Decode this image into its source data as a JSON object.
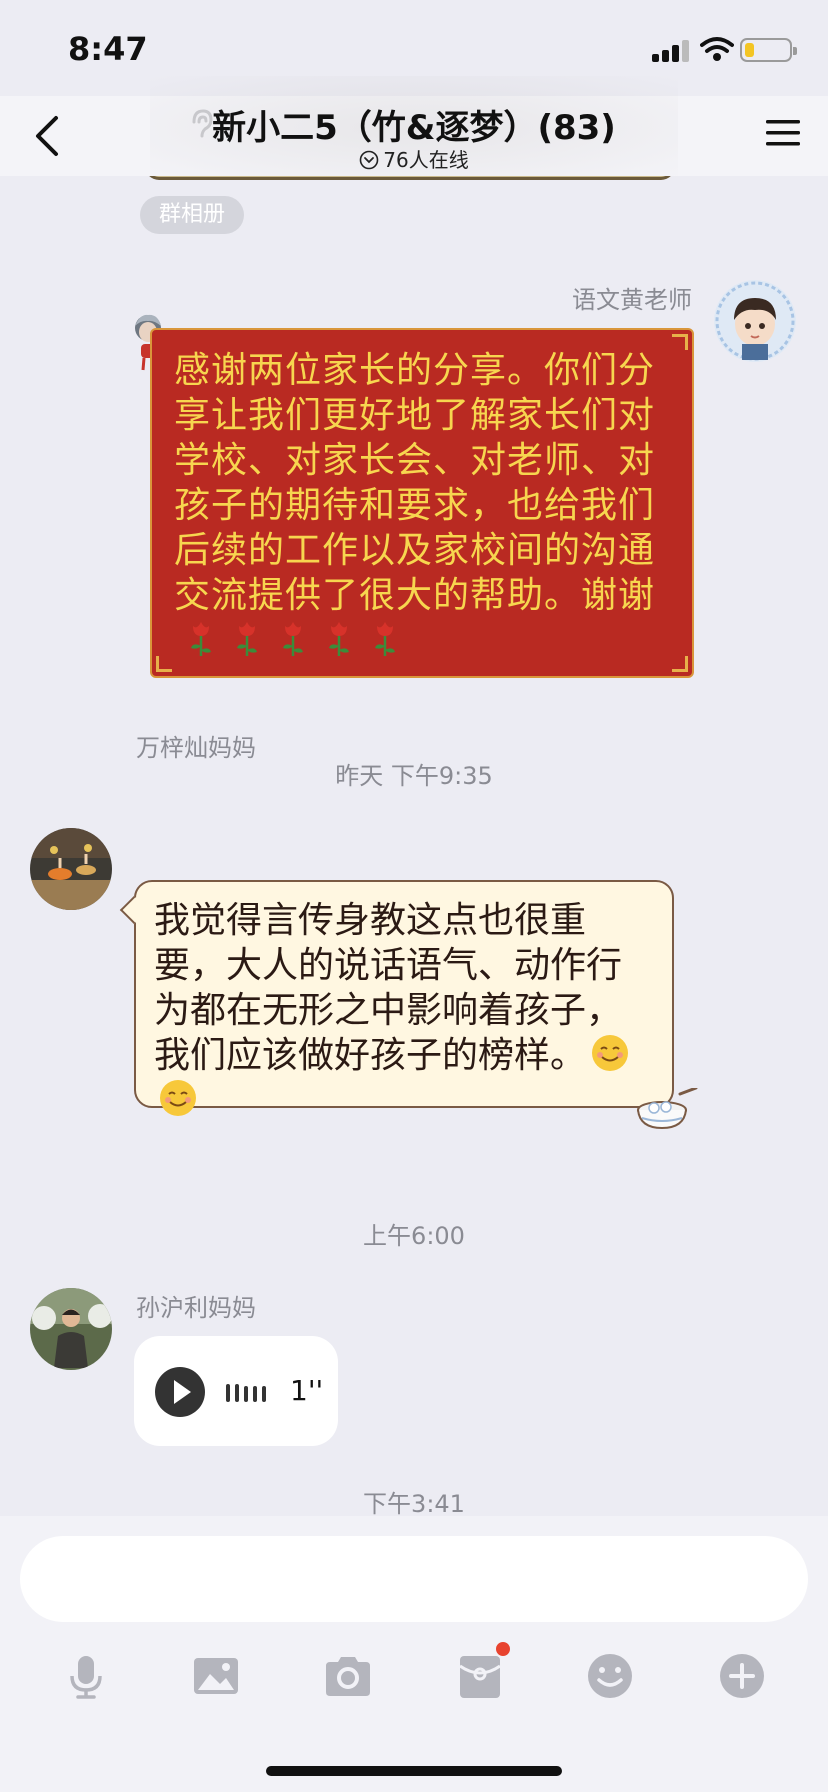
{
  "status_bar": {
    "time": "8:47",
    "battery_level": 0.2
  },
  "header": {
    "title": "新小二5（竹&逐梦）(83)",
    "online": "76人在线"
  },
  "chat": {
    "album_tag": "群相册",
    "messages": [
      {
        "sender": "语文黄老师",
        "text": "感谢两位家长的分享。你们分享让我们更好地了解家长们对学校、对家长会、对老师、对孩子的期待和要求，也给我们后续的工作以及家校间的沟通交流提供了很大的帮助。谢谢",
        "emoji": "rose",
        "emoji_count": 5
      },
      {
        "time": "昨天 下午9:35"
      },
      {
        "sender": "万梓灿妈妈",
        "text": "我觉得言传身教这点也很重要，大人的说话语气、动作行为都在无形之中影响着孩子，我们应该做好孩子的榜样。",
        "emoji": "smiling-face",
        "emoji_count": 2
      },
      {
        "time": "上午6:00"
      },
      {
        "sender": "孙沪利妈妈",
        "voice_duration": "1''"
      },
      {
        "time": "下午3:41"
      }
    ]
  },
  "input": {
    "placeholder": "",
    "toolbar": [
      "microphone-icon",
      "image-icon",
      "camera-icon",
      "red-packet-icon",
      "emoji-icon",
      "plus-icon"
    ],
    "red_packet_badge": true
  },
  "colors": {
    "background": "#ececf3",
    "red_bubble": "#b92a22",
    "red_bubble_text": "#f7d64f",
    "cream_bubble": "#fff7e1",
    "badge": "#e8432f"
  }
}
